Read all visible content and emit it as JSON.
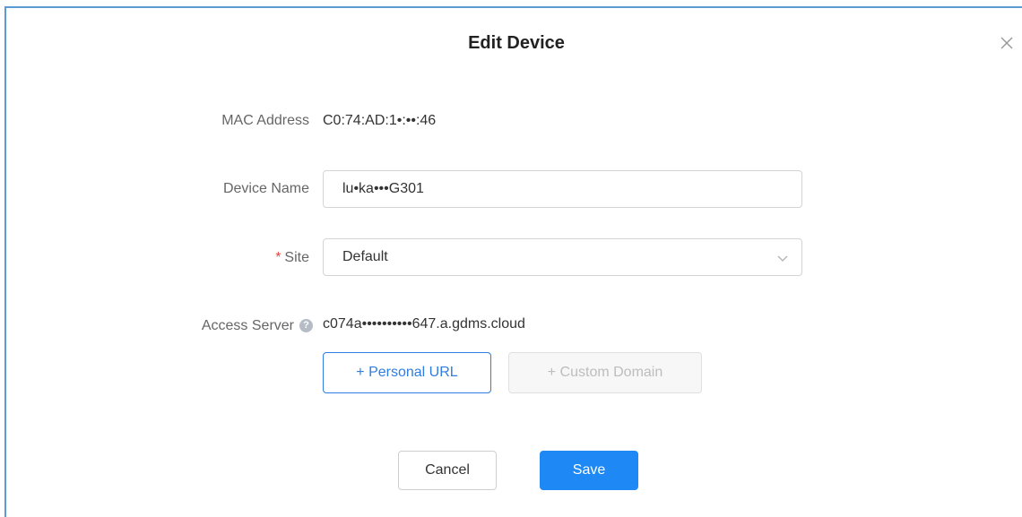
{
  "dialog": {
    "title": "Edit Device",
    "close_icon": "close-icon"
  },
  "form": {
    "mac_address": {
      "label": "MAC Address",
      "value": "C0:74:AD:1•:••:46"
    },
    "device_name": {
      "label": "Device Name",
      "value": "lu•ka•••G301"
    },
    "site": {
      "label": "Site",
      "required_mark": "*",
      "value": "Default"
    },
    "access_server": {
      "label": "Access Server",
      "help_icon": "question-circle-icon",
      "value": "c074a••••••••••647.a.gdms.cloud"
    }
  },
  "actions": {
    "personal_url": "+ Personal URL",
    "custom_domain": "+ Custom Domain",
    "cancel": "Cancel",
    "save": "Save"
  },
  "colors": {
    "accent": "#1e88f5",
    "required": "#e8453c",
    "window_border": "#5b9bd5"
  }
}
